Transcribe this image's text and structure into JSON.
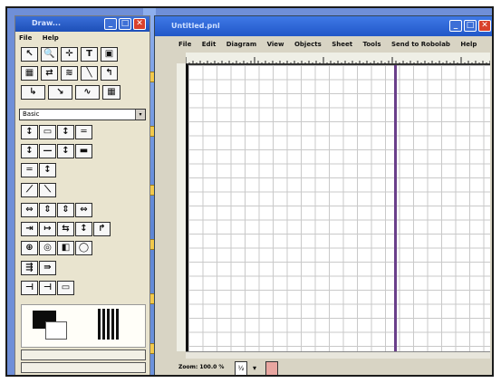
{
  "palette": {
    "title": "Draw...",
    "menu": [
      "File",
      "Help"
    ],
    "tools_row1": [
      "↖",
      "🔍",
      "✛",
      "T",
      "▣"
    ],
    "tools_row2": [
      "▦",
      "⇄",
      "≋",
      "╲",
      "↰"
    ],
    "tools_row3": [
      "↳",
      "↘",
      "∿",
      "▦"
    ],
    "dropdown_value": "Basic",
    "dropdown_arrow": "▾",
    "shapes": [
      [
        "↕",
        "▭",
        "↕",
        "═"
      ],
      [
        "↕",
        "—",
        "↕",
        "▬"
      ],
      [
        "═",
        "↕"
      ],
      [
        "⟋",
        "⟍"
      ],
      [
        "⇔",
        "⇕",
        "⇕",
        "⇔"
      ],
      [
        "⇥",
        "↦",
        "⇆",
        "↕",
        "↱"
      ],
      [
        "⊕",
        "◎",
        "◧",
        "◯"
      ],
      [
        "⇶",
        "⇛"
      ],
      [
        "⊣",
        "⊣",
        "▭"
      ]
    ]
  },
  "window": {
    "title": "Untitled.pnl",
    "close_label": "✕",
    "min_label": "_",
    "max_label": "□",
    "menu": [
      "File",
      "Edit",
      "Diagram",
      "View",
      "Objects",
      "Sheet",
      "Tools",
      "Send to Robolab",
      "Help"
    ]
  },
  "status": {
    "zoom_label": "Zoom: 100.0 %",
    "zoom_btn": "½",
    "down_arrow": "▾"
  },
  "taskbar_buttons": [
    "_",
    "□",
    "✕"
  ],
  "colors": {
    "titlebar": "#2157c8",
    "vline": "#6a3f8a",
    "palette_bg": "#e9e4cf"
  }
}
